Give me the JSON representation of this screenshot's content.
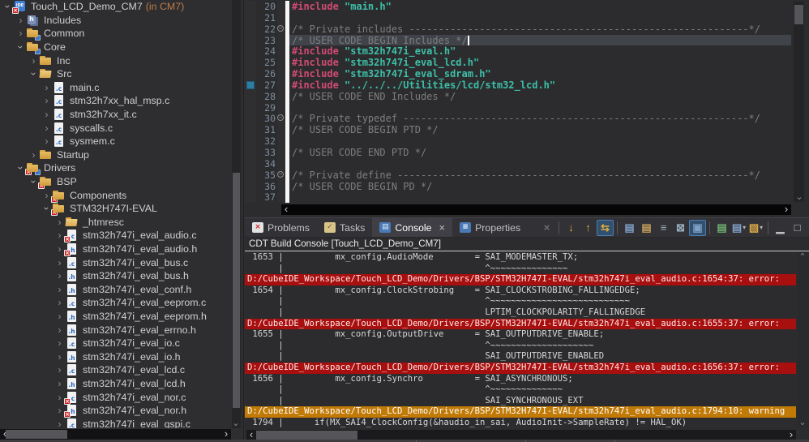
{
  "colors": {
    "background": "#2f2f32",
    "editor_bg": "#2c2c2e",
    "explorer_bg": "#2e2e31",
    "error_row_bg": "#a80f0f",
    "warning_row_bg": "#c17a06",
    "directive": "#d14b73",
    "string": "#3dbfa8",
    "comment": "#7e7e7e",
    "line_number": "#7d8ea0",
    "project_suffix": "#bd7d46",
    "fold_bar": "#f6f6f6"
  },
  "explorer": {
    "rows": [
      {
        "label": "Touch_LCD_Demo_CM7",
        "suffix": "(in CM7)",
        "level": 0,
        "chev": "v",
        "icon": "project",
        "err": true
      },
      {
        "label": "Includes",
        "level": 1,
        "chev": ">",
        "icon": "includes"
      },
      {
        "label": "Common",
        "level": 1,
        "chev": ">",
        "icon": "folder",
        "cdt": true
      },
      {
        "label": "Core",
        "level": 1,
        "chev": "v",
        "icon": "folder",
        "cdt": true
      },
      {
        "label": "Inc",
        "level": 2,
        "chev": ">",
        "icon": "folder"
      },
      {
        "label": "Src",
        "level": 2,
        "chev": "v",
        "icon": "folder-open"
      },
      {
        "label": "main.c",
        "level": 3,
        "chev": ">",
        "icon": "file-c",
        "ext": ".c"
      },
      {
        "label": "stm32h7xx_hal_msp.c",
        "level": 3,
        "chev": ">",
        "icon": "file-c",
        "ext": ".c"
      },
      {
        "label": "stm32h7xx_it.c",
        "level": 3,
        "chev": ">",
        "icon": "file-c",
        "ext": ".c"
      },
      {
        "label": "syscalls.c",
        "level": 3,
        "chev": ">",
        "icon": "file-c",
        "ext": ".c"
      },
      {
        "label": "sysmem.c",
        "level": 3,
        "chev": ">",
        "icon": "file-c",
        "ext": ".c"
      },
      {
        "label": "Startup",
        "level": 2,
        "chev": ">",
        "icon": "folder"
      },
      {
        "label": "Drivers",
        "level": 1,
        "chev": "v",
        "icon": "folder",
        "err": true,
        "cdt": true
      },
      {
        "label": "BSP",
        "level": 2,
        "chev": "v",
        "icon": "folder",
        "err": true
      },
      {
        "label": "Components",
        "level": 3,
        "chev": ">",
        "icon": "folder",
        "err": true
      },
      {
        "label": "STM32H747I-EVAL",
        "level": 3,
        "chev": "v",
        "icon": "folder",
        "err": true
      },
      {
        "label": "_htmresc",
        "level": 4,
        "chev": ">",
        "icon": "folder-open"
      },
      {
        "label": "stm32h747i_eval_audio.c",
        "level": 4,
        "chev": ">",
        "icon": "file-c",
        "ext": ".c",
        "err": true
      },
      {
        "label": "stm32h747i_eval_audio.h",
        "level": 4,
        "chev": ">",
        "icon": "file-h",
        "ext": ".h",
        "err": true
      },
      {
        "label": "stm32h747i_eval_bus.c",
        "level": 4,
        "chev": ">",
        "icon": "file-c",
        "ext": ".c"
      },
      {
        "label": "stm32h747i_eval_bus.h",
        "level": 4,
        "chev": ">",
        "icon": "file-h",
        "ext": ".h"
      },
      {
        "label": "stm32h747i_eval_conf.h",
        "level": 4,
        "chev": ">",
        "icon": "file-h",
        "ext": ".h"
      },
      {
        "label": "stm32h747i_eval_eeprom.c",
        "level": 4,
        "chev": ">",
        "icon": "file-c",
        "ext": ".c"
      },
      {
        "label": "stm32h747i_eval_eeprom.h",
        "level": 4,
        "chev": ">",
        "icon": "file-h",
        "ext": ".h"
      },
      {
        "label": "stm32h747i_eval_errno.h",
        "level": 4,
        "chev": ">",
        "icon": "file-h",
        "ext": ".h"
      },
      {
        "label": "stm32h747i_eval_io.c",
        "level": 4,
        "chev": ">",
        "icon": "file-c",
        "ext": ".c"
      },
      {
        "label": "stm32h747i_eval_io.h",
        "level": 4,
        "chev": ">",
        "icon": "file-h",
        "ext": ".h"
      },
      {
        "label": "stm32h747i_eval_lcd.c",
        "level": 4,
        "chev": ">",
        "icon": "file-c",
        "ext": ".c"
      },
      {
        "label": "stm32h747i_eval_lcd.h",
        "level": 4,
        "chev": ">",
        "icon": "file-h",
        "ext": ".h"
      },
      {
        "label": "stm32h747i_eval_nor.c",
        "level": 4,
        "chev": ">",
        "icon": "file-c",
        "ext": ".c",
        "err": true
      },
      {
        "label": "stm32h747i_eval_nor.h",
        "level": 4,
        "chev": ">",
        "icon": "file-h",
        "ext": ".h",
        "err": true
      },
      {
        "label": "stm32h747i_eval_qspi.c",
        "level": 4,
        "chev": ">",
        "icon": "file-c",
        "ext": ".c"
      }
    ]
  },
  "editor": {
    "lines": [
      {
        "num": 20,
        "segments": [
          {
            "s": "dir",
            "t": "#include"
          },
          {
            "s": "plain",
            "t": " "
          },
          {
            "s": "str",
            "t": "\"main.h\""
          }
        ]
      },
      {
        "num": 21,
        "segments": []
      },
      {
        "num": 22,
        "fold": true,
        "segments": [
          {
            "s": "com",
            "t": "/* Private includes ----------------------------------------------------------*/"
          }
        ]
      },
      {
        "num": 23,
        "current": true,
        "cursor": true,
        "segments": [
          {
            "s": "com",
            "t": "/* USER CODE BEGIN Includes */"
          }
        ]
      },
      {
        "num": 24,
        "segments": [
          {
            "s": "dir",
            "t": "#include"
          },
          {
            "s": "plain",
            "t": " "
          },
          {
            "s": "str",
            "t": "\"stm32h747i_eval.h\""
          }
        ]
      },
      {
        "num": 25,
        "segments": [
          {
            "s": "dir",
            "t": "#include"
          },
          {
            "s": "plain",
            "t": " "
          },
          {
            "s": "str",
            "t": "\"stm32h747i_eval_lcd.h\""
          }
        ]
      },
      {
        "num": 26,
        "segments": [
          {
            "s": "dir",
            "t": "#include"
          },
          {
            "s": "plain",
            "t": " "
          },
          {
            "s": "str",
            "t": "\"stm32h747i_eval_sdram.h\""
          }
        ]
      },
      {
        "num": 27,
        "marker": true,
        "segments": [
          {
            "s": "dir",
            "t": "#include"
          },
          {
            "s": "plain",
            "t": " "
          },
          {
            "s": "str",
            "t": "\"../../../Utilities/lcd/stm32_lcd.h\""
          }
        ]
      },
      {
        "num": 28,
        "segments": [
          {
            "s": "com",
            "t": "/* USER CODE END Includes */"
          }
        ]
      },
      {
        "num": 29,
        "segments": []
      },
      {
        "num": 30,
        "fold": true,
        "segments": [
          {
            "s": "com",
            "t": "/* Private typedef -----------------------------------------------------------*/"
          }
        ]
      },
      {
        "num": 31,
        "segments": [
          {
            "s": "com",
            "t": "/* USER CODE BEGIN PTD */"
          }
        ]
      },
      {
        "num": 32,
        "segments": []
      },
      {
        "num": 33,
        "segments": [
          {
            "s": "com",
            "t": "/* USER CODE END PTD */"
          }
        ]
      },
      {
        "num": 34,
        "segments": []
      },
      {
        "num": 35,
        "fold": true,
        "segments": [
          {
            "s": "com",
            "t": "/* Private define ------------------------------------------------------------*/"
          }
        ]
      },
      {
        "num": 36,
        "segments": [
          {
            "s": "com",
            "t": "/* USER CODE BEGIN PD */"
          }
        ]
      },
      {
        "num": 37,
        "segments": []
      }
    ]
  },
  "console": {
    "title": "CDT Build Console [Touch_LCD_Demo_CM7]",
    "tabs": [
      {
        "label": "Problems",
        "glyph": "×",
        "iconBg": "#e3e3e3",
        "iconColor": "#cc2222"
      },
      {
        "label": "Tasks",
        "glyph": "✓",
        "iconBg": "#d8c389",
        "iconColor": "#6b5b1e"
      },
      {
        "label": "Console",
        "glyph": "▤",
        "iconBg": "#4a7ab5",
        "iconColor": "#e2edf8",
        "active": true,
        "closable": true
      },
      {
        "label": "Properties",
        "glyph": "≡",
        "iconBg": "#4a7ab5",
        "iconColor": "#ffffff"
      }
    ],
    "toolbar": [
      {
        "name": "remove-launch-button",
        "glyph": "×",
        "color": "#8a8a8a",
        "disabled": true
      },
      {
        "sep": true
      },
      {
        "name": "next-console-button",
        "glyph": "↓",
        "color": "#e0a93e"
      },
      {
        "name": "previous-console-button",
        "glyph": "↑",
        "color": "#e0a93e"
      },
      {
        "name": "word-wrap-toggle",
        "glyph": "⇆",
        "color": "#e0a93e",
        "active": true
      },
      {
        "sep": true
      },
      {
        "name": "show-on-stdout-toggle",
        "glyph": "▤",
        "color": "#7f9fc6"
      },
      {
        "name": "show-on-stderr-toggle",
        "glyph": "▤",
        "color": "#c6a05a"
      },
      {
        "name": "wrap-lines-toggle",
        "glyph": "≡",
        "color": "#9ab0c0"
      },
      {
        "name": "clear-console-button",
        "glyph": "⊠",
        "color": "#9ab0c0"
      },
      {
        "name": "pin-console-toggle",
        "glyph": "▣",
        "color": "#7f9fc6",
        "active": true
      },
      {
        "sep": true
      },
      {
        "name": "display-selected-console-button",
        "glyph": "▤",
        "color": "#6fae6f"
      },
      {
        "name": "open-console-dropdown",
        "glyph": "▤",
        "color": "#7f9fc6",
        "dropdown": true
      },
      {
        "name": "new-console-dropdown",
        "glyph": "▧",
        "color": "#d9a946",
        "dropdown": true
      },
      {
        "sep": true
      },
      {
        "name": "minimize-button",
        "glyph": "▁",
        "color": "#c0c0c0"
      },
      {
        "name": "maximize-button",
        "glyph": "□",
        "color": "#c0c0c0"
      }
    ],
    "lines": [
      {
        "type": "src",
        "num": "1653",
        "indent": 10,
        "code": "mx_config.AudioMode        = SAI_MODEMASTER_TX;"
      },
      {
        "type": "mark",
        "indent": 39,
        "code": "^~~~~~~~~~~~~~~~"
      },
      {
        "type": "error",
        "text": "D:/CubeIDE_Workspace/Touch_LCD_Demo/Drivers/BSP/STM32H747I-EVAL/stm32h747i_eval_audio.c:1654:37: error:"
      },
      {
        "type": "src",
        "num": "1654",
        "indent": 10,
        "code": "mx_config.ClockStrobing    = SAI_CLOCKSTROBING_FALLINGEDGE;"
      },
      {
        "type": "mark",
        "indent": 39,
        "code": "^~~~~~~~~~~~~~~~~~~~~~~~~~~~"
      },
      {
        "type": "sug",
        "indent": 39,
        "code": "LPTIM_CLOCKPOLARITY_FALLINGEDGE"
      },
      {
        "type": "error",
        "text": "D:/CubeIDE_Workspace/Touch_LCD_Demo/Drivers/BSP/STM32H747I-EVAL/stm32h747i_eval_audio.c:1655:37: error:"
      },
      {
        "type": "src",
        "num": "1655",
        "indent": 10,
        "code": "mx_config.OutputDrive      = SAI_OUTPUTDRIVE_ENABLE;"
      },
      {
        "type": "mark",
        "indent": 39,
        "code": "^~~~~~~~~~~~~~~~~~~~~"
      },
      {
        "type": "sug",
        "indent": 39,
        "code": "SAI_OUTPUTDRIVE_ENABLED"
      },
      {
        "type": "error",
        "text": "D:/CubeIDE_Workspace/Touch_LCD_Demo/Drivers/BSP/STM32H747I-EVAL/stm32h747i_eval_audio.c:1656:37: error:"
      },
      {
        "type": "src",
        "num": "1656",
        "indent": 10,
        "code": "mx_config.Synchro          = SAI_ASYNCHRONOUS;"
      },
      {
        "type": "mark",
        "indent": 39,
        "code": "^~~~~~~~~~~~~~~"
      },
      {
        "type": "sug",
        "indent": 39,
        "code": "SAI_SYNCHRONOUS_EXT"
      },
      {
        "type": "warning",
        "text": "D:/CubeIDE_Workspace/Touch_LCD_Demo/Drivers/BSP/STM32H747I-EVAL/stm32h747i_eval_audio.c:1794:10: warning"
      },
      {
        "type": "src",
        "num": "1794",
        "indent": 6,
        "code": "if(MX_SAI4_ClockConfig(&haudio_in_sai, AudioInit->SampleRate) != HAL_OK)"
      }
    ]
  }
}
